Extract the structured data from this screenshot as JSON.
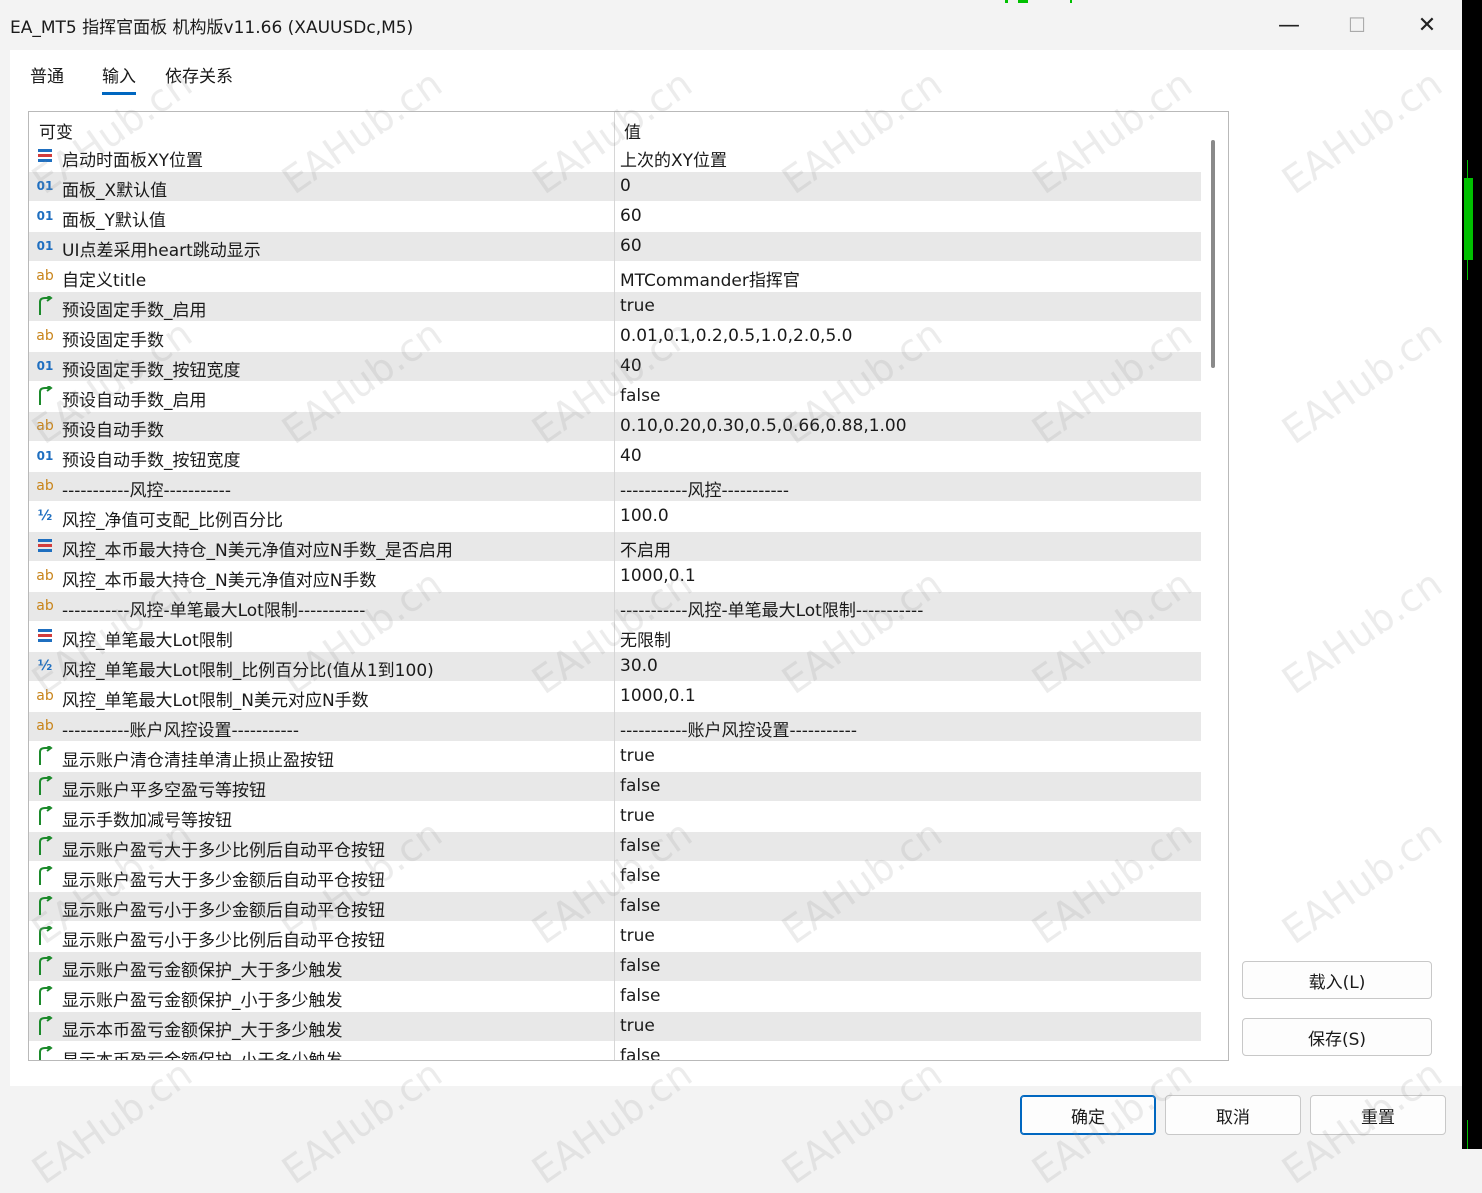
{
  "window": {
    "title": "EA_MT5 指挥官面板 机构版v11.66 (XAUUSDc,M5)",
    "minimize_glyph": "—",
    "maximize_glyph": "☐",
    "close_glyph": "✕"
  },
  "tabs": [
    "普通",
    "输入",
    "依存关系"
  ],
  "active_tab": "输入",
  "table": {
    "col_variable": "可变",
    "col_value": "值",
    "rows": [
      {
        "type": "enum",
        "name": "启动时面板XY位置",
        "value": "上次的XY位置"
      },
      {
        "type": "int",
        "name": "面板_X默认值",
        "value": "0"
      },
      {
        "type": "int",
        "name": "面板_Y默认值",
        "value": "60"
      },
      {
        "type": "int",
        "name": "UI点差采用heart跳动显示",
        "value": "60"
      },
      {
        "type": "string",
        "name": "自定义title",
        "value": "MTCommander指挥官"
      },
      {
        "type": "bool",
        "name": "预设固定手数_启用",
        "value": "true"
      },
      {
        "type": "string",
        "name": "预设固定手数",
        "value": "0.01,0.1,0.2,0.5,1.0,2.0,5.0"
      },
      {
        "type": "int",
        "name": "预设固定手数_按钮宽度",
        "value": "40"
      },
      {
        "type": "bool",
        "name": "预设自动手数_启用",
        "value": "false"
      },
      {
        "type": "string",
        "name": "预设自动手数",
        "value": "0.10,0.20,0.30,0.5,0.66,0.88,1.00"
      },
      {
        "type": "int",
        "name": "预设自动手数_按钮宽度",
        "value": "40"
      },
      {
        "type": "string",
        "name": "-----------风控-----------",
        "value": "-----------风控-----------"
      },
      {
        "type": "double",
        "name": "风控_净值可支配_比例百分比",
        "value": "100.0"
      },
      {
        "type": "enum",
        "name": "风控_本币最大持仓_N美元净值对应N手数_是否启用",
        "value": "不启用"
      },
      {
        "type": "string",
        "name": "风控_本币最大持仓_N美元净值对应N手数",
        "value": "1000,0.1"
      },
      {
        "type": "string",
        "name": "-----------风控-单笔最大Lot限制-----------",
        "value": "-----------风控-单笔最大Lot限制-----------"
      },
      {
        "type": "enum",
        "name": "风控_单笔最大Lot限制",
        "value": "无限制"
      },
      {
        "type": "double",
        "name": "风控_单笔最大Lot限制_比例百分比(值从1到100)",
        "value": "30.0"
      },
      {
        "type": "string",
        "name": "风控_单笔最大Lot限制_N美元对应N手数",
        "value": "1000,0.1"
      },
      {
        "type": "string",
        "name": "-----------账户风控设置-----------",
        "value": "-----------账户风控设置-----------"
      },
      {
        "type": "bool",
        "name": "显示账户清仓清挂单清止损止盈按钮",
        "value": "true"
      },
      {
        "type": "bool",
        "name": "显示账户平多空盈亏等按钮",
        "value": "false"
      },
      {
        "type": "bool",
        "name": "显示手数加减号等按钮",
        "value": "true"
      },
      {
        "type": "bool",
        "name": "显示账户盈亏大于多少比例后自动平仓按钮",
        "value": "false"
      },
      {
        "type": "bool",
        "name": "显示账户盈亏大于多少金额后自动平仓按钮",
        "value": "false"
      },
      {
        "type": "bool",
        "name": "显示账户盈亏小于多少金额后自动平仓按钮",
        "value": "false"
      },
      {
        "type": "bool",
        "name": "显示账户盈亏小于多少比例后自动平仓按钮",
        "value": "true"
      },
      {
        "type": "bool",
        "name": "显示账户盈亏金额保护_大于多少触发",
        "value": "false"
      },
      {
        "type": "bool",
        "name": "显示账户盈亏金额保护_小于多少触发",
        "value": "false"
      },
      {
        "type": "bool",
        "name": "显示本币盈亏金额保护_大于多少触发",
        "value": "true"
      },
      {
        "type": "bool",
        "name": "显示本币盈亏金额保护_小于多少触发",
        "value": "false"
      }
    ]
  },
  "side_buttons": {
    "load": "载入(L)",
    "save": "保存(S)"
  },
  "bottom_buttons": {
    "ok": "确定",
    "cancel": "取消",
    "reset": "重置"
  },
  "watermark": "EAHub.cn",
  "icons": {
    "int": "01",
    "string": "ab",
    "bool": "bool-arrow-icon",
    "enum": "enum-icon",
    "double": "½"
  }
}
